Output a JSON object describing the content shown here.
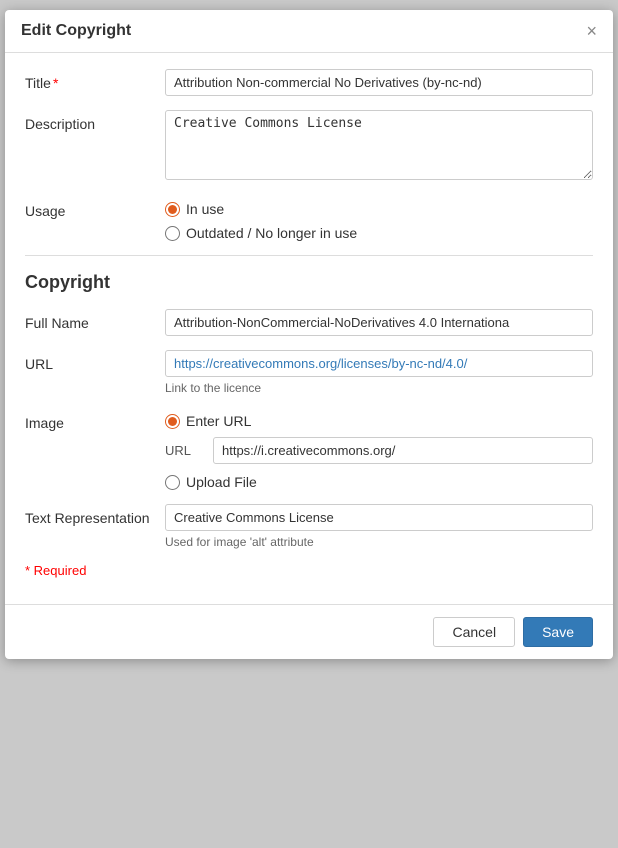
{
  "modal": {
    "title": "Edit Copyright",
    "close_icon": "×"
  },
  "form": {
    "title_label": "Title",
    "title_value": "Attribution Non-commercial No Derivatives (by-nc-nd)",
    "description_label": "Description",
    "description_value": "Creative Commons License",
    "usage_label": "Usage",
    "usage_options": [
      {
        "label": "In use",
        "value": "in_use",
        "checked": true
      },
      {
        "label": "Outdated / No longer in use",
        "value": "outdated",
        "checked": false
      }
    ],
    "section_title": "Copyright",
    "fullname_label": "Full Name",
    "fullname_value": "Attribution-NonCommercial-NoDerivatives 4.0 Internationa",
    "url_label": "URL",
    "url_value": "https://creativecommons.org/licenses/by-nc-nd/4.0/",
    "url_hint": "Link to the licence",
    "image_label": "Image",
    "image_options": [
      {
        "label": "Enter URL",
        "value": "enter_url",
        "checked": true
      },
      {
        "label": "Upload File",
        "value": "upload_file",
        "checked": false
      }
    ],
    "image_url_label": "URL",
    "image_url_value": "https://i.creativecommons.org/",
    "text_rep_label": "Text Representation",
    "text_rep_value": "Creative Commons License",
    "text_rep_hint": "Used for image 'alt' attribute",
    "required_note": "Required"
  },
  "footer": {
    "cancel_label": "Cancel",
    "save_label": "Save"
  }
}
